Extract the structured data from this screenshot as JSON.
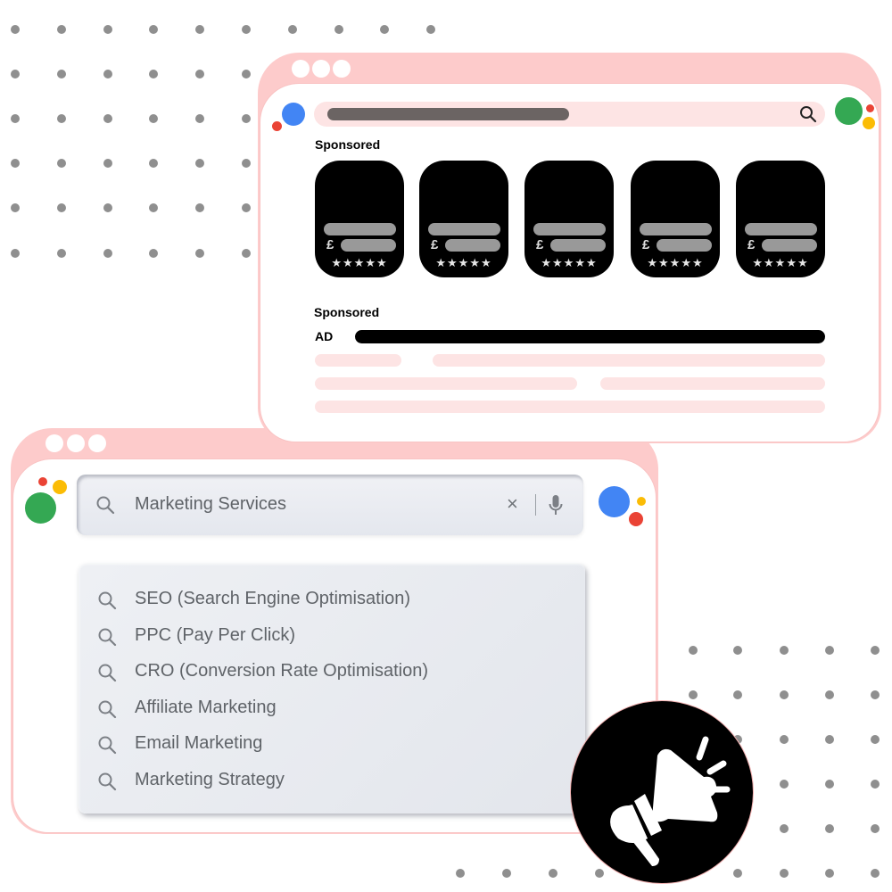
{
  "ads_window": {
    "window_controls": [
      "close",
      "minimize",
      "maximize"
    ],
    "search_icon": "search-icon",
    "sponsored_products_label": "Sponsored",
    "product_cards": [
      {
        "currency_symbol": "£",
        "rating_stars": "★★★★★"
      },
      {
        "currency_symbol": "£",
        "rating_stars": "★★★★★"
      },
      {
        "currency_symbol": "£",
        "rating_stars": "★★★★★"
      },
      {
        "currency_symbol": "£",
        "rating_stars": "★★★★★"
      },
      {
        "currency_symbol": "£",
        "rating_stars": "★★★★★"
      }
    ],
    "sponsored_text_label": "Sponsored",
    "ad_badge": "AD"
  },
  "search_window": {
    "window_controls": [
      "close",
      "minimize",
      "maximize"
    ],
    "search": {
      "value": "Marketing Services",
      "clear_glyph": "×",
      "mic_icon": "microphone-icon"
    },
    "suggestions": [
      "SEO (Search Engine Optimisation)",
      "PPC (Pay Per Click)",
      "CRO (Conversion Rate Optimisation)",
      "Affiliate Marketing",
      "Email Marketing",
      "Marketing Strategy"
    ]
  },
  "badge": {
    "icon": "megaphone-icon"
  },
  "colors": {
    "frame_pink": "#fdcbcb",
    "placeholder_pink": "#fde4e4",
    "google_blue": "#4285f4",
    "google_red": "#ea4335",
    "google_yellow": "#fbbc05",
    "google_green": "#34a853",
    "dot_grey": "#8f8f8f"
  }
}
